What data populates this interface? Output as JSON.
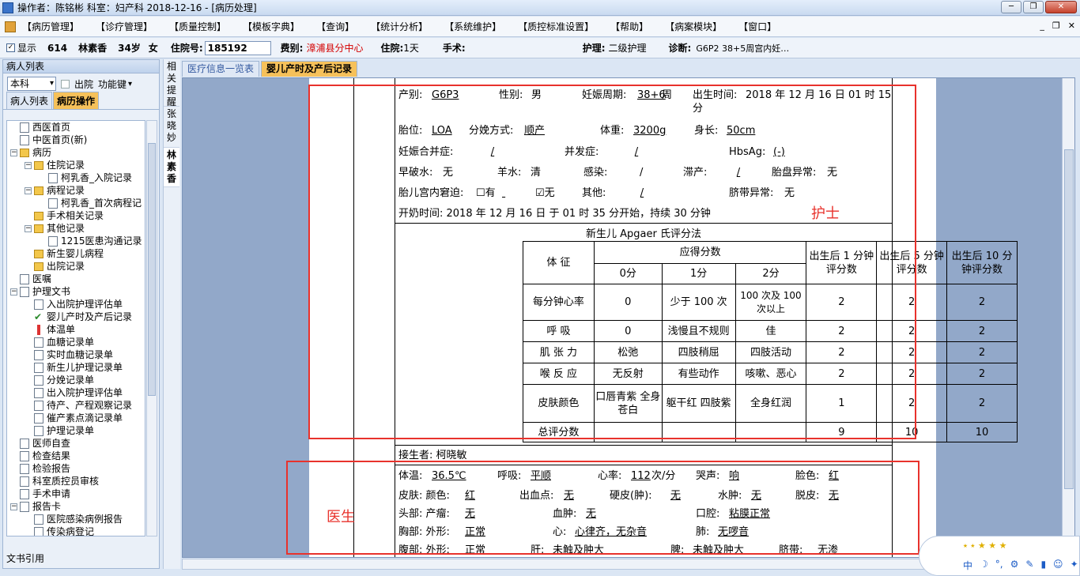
{
  "window": {
    "title": "操作者：陈铭彬   科室：妇产科   2018-12-16 - [病历处理]",
    "controls": [
      "─",
      "❐",
      "✕"
    ]
  },
  "menu": {
    "items": [
      "【病历管理】",
      "【诊疗管理】",
      "【质量控制】",
      "【模板字典】",
      "【查询】",
      "【统计分析】",
      "【系统维护】",
      "【质控标准设置】",
      "【帮助】",
      "【病案模块】",
      "【窗口】"
    ],
    "mdi_controls": [
      "_",
      "❐",
      "✕"
    ]
  },
  "patient": {
    "show_label": "显示",
    "bed": "614",
    "name": "林素香",
    "age": "34岁",
    "sex": "女",
    "hosp_no_label": "住院号:",
    "hosp_no": "185192",
    "fee_label": "费别:",
    "fee": "漳浦县分中心",
    "stay_label": "住院:",
    "stay": "1天",
    "surgery_label": "手术:",
    "nursing_label": "护理:",
    "nursing": "二级护理",
    "diag_label": "诊断:",
    "diag": "G6P2  38+5周宫内妊…"
  },
  "left_panel": {
    "title": "病人列表",
    "dept_select": "本科",
    "discharge_label": "出院",
    "func_label": "功能键",
    "tabs": [
      "病人列表",
      "病历操作"
    ],
    "bottom_label": "文书引用",
    "tree": [
      {
        "label": "西医首页",
        "level": 1,
        "icon": "doc"
      },
      {
        "label": "中医首页(新)",
        "level": 1,
        "icon": "doc"
      },
      {
        "label": "病历",
        "level": 1,
        "icon": "folder",
        "exp": "−"
      },
      {
        "label": "住院记录",
        "level": 2,
        "icon": "folder",
        "exp": "−"
      },
      {
        "label": "柯乳香_入院记录",
        "level": 3,
        "icon": "doc"
      },
      {
        "label": "病程记录",
        "level": 2,
        "icon": "folder",
        "exp": "−"
      },
      {
        "label": "柯乳香_首次病程记",
        "level": 3,
        "icon": "doc"
      },
      {
        "label": "手术相关记录",
        "level": 2,
        "icon": "folder"
      },
      {
        "label": "其他记录",
        "level": 2,
        "icon": "folder",
        "exp": "−"
      },
      {
        "label": "1215医患沟通记录",
        "level": 3,
        "icon": "doc"
      },
      {
        "label": "新生婴儿病程",
        "level": 2,
        "icon": "folder"
      },
      {
        "label": "出院记录",
        "level": 2,
        "icon": "folder"
      },
      {
        "label": "医嘱",
        "level": 1,
        "icon": "doc"
      },
      {
        "label": "护理文书",
        "level": 1,
        "icon": "doc",
        "exp": "−"
      },
      {
        "label": "入出院护理评估单",
        "level": 2,
        "icon": "doc"
      },
      {
        "label": "婴儿产时及产后记录",
        "level": 2,
        "icon": "check"
      },
      {
        "label": "体温单",
        "level": 2,
        "icon": "therm"
      },
      {
        "label": "血糖记录单",
        "level": 2,
        "icon": "doc"
      },
      {
        "label": "实时血糖记录单",
        "level": 2,
        "icon": "doc"
      },
      {
        "label": "新生儿护理记录单",
        "level": 2,
        "icon": "doc"
      },
      {
        "label": "分娩记录单",
        "level": 2,
        "icon": "doc"
      },
      {
        "label": "出入院护理评估单",
        "level": 2,
        "icon": "doc"
      },
      {
        "label": "待产、产程观察记录",
        "level": 2,
        "icon": "doc"
      },
      {
        "label": "催产素点滴记录单",
        "level": 2,
        "icon": "doc"
      },
      {
        "label": "护理记录单",
        "level": 2,
        "icon": "doc"
      },
      {
        "label": "医师自查",
        "level": 1,
        "icon": "doc"
      },
      {
        "label": "检查结果",
        "level": 1,
        "icon": "doc"
      },
      {
        "label": "检验报告",
        "level": 1,
        "icon": "doc"
      },
      {
        "label": "科室质控员审核",
        "level": 1,
        "icon": "doc"
      },
      {
        "label": "手术申请",
        "level": 1,
        "icon": "doc"
      },
      {
        "label": "报告卡",
        "level": 1,
        "icon": "doc",
        "exp": "−"
      },
      {
        "label": "医院感染病例报告",
        "level": 2,
        "icon": "doc"
      },
      {
        "label": "传染病登记",
        "level": 2,
        "icon": "doc"
      }
    ]
  },
  "side_tabs": [
    "相关提醒",
    "张晓妙",
    "林素香"
  ],
  "doc_tabs": [
    "医疗信息一览表",
    "婴儿产时及产后记录"
  ],
  "form": {
    "row1": {
      "parity_label": "产别:",
      "parity": "G6P3",
      "sex_label": "性别:",
      "sex": "男",
      "ga_label": "妊娠周期:",
      "ga": "38+6",
      "ga_unit": "周",
      "birth_label": "出生时间:",
      "birth": "2018 年 12 月 16 日 01 时 15",
      "birth2": "分"
    },
    "row2": {
      "pos_label": "胎位:",
      "pos": "LOA",
      "mode_label": "分娩方式:",
      "mode": "顺产",
      "weight_label": "体重:",
      "weight": "3200g",
      "length_label": "身长:",
      "length": "50cm"
    },
    "row3": {
      "comp_label": "妊娠合并症:",
      "comp": "/",
      "compl_label": "并发症:",
      "compl": "/",
      "hbs_label": "HbsAg:",
      "hbs": "(-)"
    },
    "row4": {
      "prom_label": "早破水:",
      "prom": "无",
      "fluid_label": "羊水:",
      "fluid": "清",
      "infect_label": "感染:",
      "infect": "/",
      "labor_label": "滞产:",
      "labor": "/",
      "placenta_label": "胎盘异常:",
      "placenta": "无"
    },
    "row5": {
      "distress_label": "胎儿宫内窘迫:",
      "opt_yes": "☐有",
      "opt_no": "☑无",
      "other_label": "其他:",
      "other": "/",
      "cord_label": "脐带异常:",
      "cord": "无"
    },
    "row6": {
      "text": "开奶时间: 2018 年 12 月 16 日  于 01  时 35  分开始，持续 30 分钟"
    },
    "apgar_title": "新生儿 Apgaer 氏评分法",
    "apgar_head": {
      "sign": "体  征",
      "scores": "应得分数",
      "s0": "0分",
      "s1": "1分",
      "s2": "2分",
      "m1": "出生后 1 分钟评分数",
      "m5": "出生后 5 分钟评分数",
      "m10": "出生后 10 分钟评分数"
    },
    "apgar_rows": [
      {
        "sign": "每分钟心率",
        "s0": "0",
        "s1": "少于 100 次",
        "s2": "100 次及 100 次以上",
        "m1": "2",
        "m5": "2",
        "m10": "2"
      },
      {
        "sign": "呼  吸",
        "s0": "0",
        "s1": "浅慢且不规则",
        "s2": "佳",
        "m1": "2",
        "m5": "2",
        "m10": "2"
      },
      {
        "sign": "肌 张 力",
        "s0": "松弛",
        "s1": "四肢稍屈",
        "s2": "四肢活动",
        "m1": "2",
        "m5": "2",
        "m10": "2"
      },
      {
        "sign": "喉 反 应",
        "s0": "无反射",
        "s1": "有些动作",
        "s2": "咳嗽、恶心",
        "m1": "2",
        "m5": "2",
        "m10": "2"
      },
      {
        "sign": "皮肤颜色",
        "s0": "口唇青紫 全身苍白",
        "s1": "躯干红 四肢紫",
        "s2": "全身红润",
        "m1": "1",
        "m5": "2",
        "m10": "2"
      }
    ],
    "apgar_total": {
      "sign": "总评分数",
      "m1": "9",
      "m5": "10",
      "m10": "10"
    },
    "receiver": "接生者: 柯晓敏",
    "exam1": {
      "temp_label": "体温:",
      "temp": "36.5℃",
      "resp_label": "呼吸:",
      "resp": "平顺",
      "hr_label": "心率:",
      "hr": "112",
      "hr_unit": "次/分",
      "cry_label": "哭声:",
      "cry": "响",
      "face_label": "脸色:",
      "face": "红"
    },
    "exam2": {
      "skin_label": "皮肤: 颜色:",
      "skin": "红",
      "bleed_label": "出血点:",
      "bleed": "无",
      "scler_label": "硬皮(肿):",
      "scler": "无",
      "edema_label": "水肿:",
      "edema": "无",
      "peel_label": "脱皮:",
      "peel": "无"
    },
    "exam3": {
      "head_label": "头部: 产瘤:",
      "tumor": "无",
      "hematoma_label": "血肿:",
      "hematoma": "无",
      "mouth_label": "口腔:",
      "mouth": "粘膜正常"
    },
    "exam4": {
      "chest_label": "胸部: 外形:",
      "chest": "正常",
      "heart_label": "心:",
      "heart": "心律齐，无杂音",
      "lung_label": "肺:",
      "lung": "无啰音"
    },
    "exam5": {
      "abd_label": "腹部: 外形:",
      "abd": "正常",
      "liver_label": "肝:",
      "liver": "未触及肿大",
      "spleen_label": "脾:",
      "spleen": "未触及肿大",
      "umb_label": "脐带:",
      "umb": "无渗"
    }
  },
  "annotations": {
    "nurse": "护士",
    "doctor": "医生"
  },
  "ime": {
    "stars": "⭑ ⭑ ★ ★ ★",
    "items": [
      "中",
      "☽",
      "°,",
      "⚙",
      "✎",
      "▮",
      "☺",
      "✦"
    ]
  },
  "colors": {
    "accent_tab": "#f6c15a",
    "annotation_red": "#e8322c",
    "fee_red": "#d40000"
  }
}
